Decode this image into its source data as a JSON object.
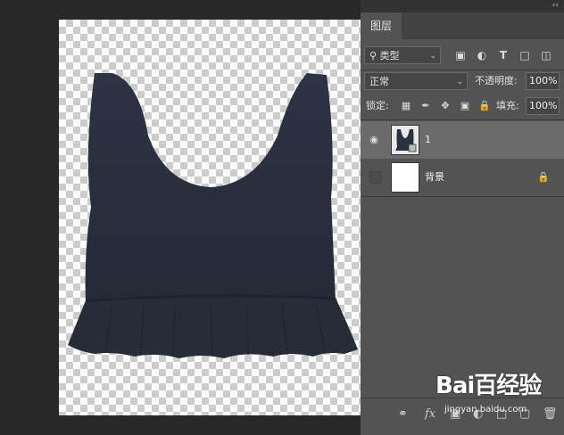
{
  "panel": {
    "tab_label": "图层",
    "collapse_glyph": "‹‹",
    "filter": {
      "selected": "类型",
      "icon": "search-icon"
    },
    "filter_icons": [
      "image-filter-icon",
      "adjustment-filter-icon",
      "text-filter-icon",
      "shape-filter-icon",
      "smart-object-filter-icon"
    ],
    "blend_mode": "正常",
    "opacity_label": "不透明度:",
    "opacity_value": "100%",
    "lock_label": "锁定:",
    "fill_label": "填充:",
    "fill_value": "100%",
    "layers": [
      {
        "name": "1",
        "visible": true,
        "selected": true
      },
      {
        "name": "背景",
        "visible": false,
        "locked": true
      }
    ]
  },
  "watermark": {
    "logo": "Bai百经验",
    "site": "jingyan.baidu.com"
  },
  "colors": {
    "panel_bg": "#535353",
    "selected_layer": "#6b6b6b",
    "app_bg": "#282828",
    "garment": "#2c3140"
  }
}
